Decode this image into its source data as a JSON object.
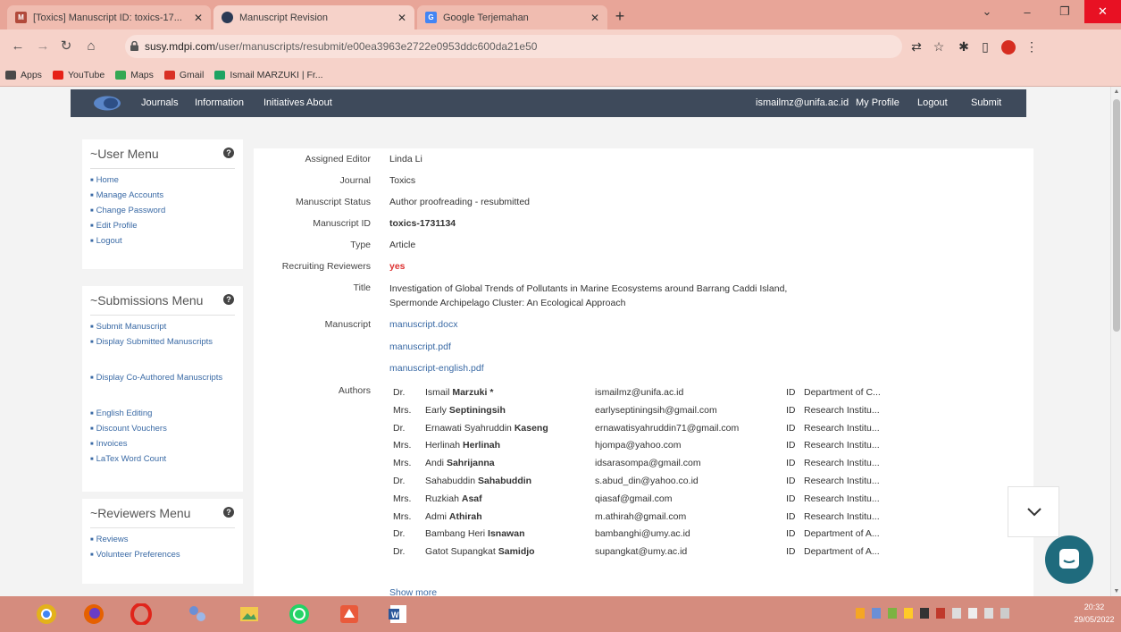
{
  "browser": {
    "tabs": [
      {
        "title": "[Toxics] Manuscript ID: toxics-17...",
        "favicon": "mdpi-icon",
        "active": false
      },
      {
        "title": "Manuscript Revision",
        "favicon": "susy-icon",
        "active": true
      },
      {
        "title": "Google Terjemahan",
        "favicon": "google-translate-icon",
        "active": false
      }
    ],
    "url_host": "susy.mdpi.com",
    "url_path": "/user/manuscripts/resubmit/e00ea3963e2722e0953ddc600da21e50",
    "bookmarks": [
      {
        "label": "Apps",
        "icon": "apps-icon",
        "color": "#4a4a4a"
      },
      {
        "label": "YouTube",
        "icon": "youtube-icon",
        "color": "#e62117"
      },
      {
        "label": "Maps",
        "icon": "maps-icon",
        "color": "#34a853"
      },
      {
        "label": "Gmail",
        "icon": "gmail-icon",
        "color": "#d93025"
      },
      {
        "label": "Ismail MARZUKI | Fr...",
        "icon": "bookmark-site-icon",
        "color": "#1ea362"
      }
    ]
  },
  "site_nav": {
    "links": [
      "Journals",
      "Information",
      "Initiatives",
      "About"
    ],
    "user_email": "ismailmz@unifa.ac.id",
    "right_links": [
      "My Profile",
      "Logout",
      "Submit"
    ]
  },
  "sidebar": {
    "user_menu": {
      "title": "User Menu",
      "items": [
        "Home",
        "Manage Accounts",
        "Change Password",
        "Edit Profile",
        "Logout"
      ]
    },
    "submissions_menu": {
      "title": "Submissions Menu",
      "items": [
        "Submit Manuscript",
        "Display Submitted Manuscripts",
        "Display Co-Authored Manuscripts",
        "English Editing",
        "Discount Vouchers",
        "Invoices",
        "LaTex Word Count"
      ]
    },
    "reviewers_menu": {
      "title": "Reviewers Menu",
      "items": [
        "Reviews",
        "Volunteer Preferences"
      ]
    }
  },
  "manuscript": {
    "labels": {
      "editor": "Assigned Editor",
      "journal": "Journal",
      "status": "Manuscript Status",
      "id": "Manuscript ID",
      "type": "Type",
      "recruiting": "Recruiting Reviewers",
      "title": "Title",
      "files": "Manuscript",
      "authors": "Authors"
    },
    "editor": "Linda Li",
    "journal": "Toxics",
    "status": "Author proofreading - resubmitted",
    "id": "toxics-1731134",
    "type": "Article",
    "recruiting": "yes",
    "title_line1": "Investigation of Global Trends of Pollutants in Marine Ecosystems around Barrang Caddi Island,",
    "title_line2": "Spermonde Archipelago Cluster: An Ecological Approach",
    "files": [
      "manuscript.docx",
      "manuscript.pdf",
      "manuscript-english.pdf"
    ],
    "show_more": "Show more"
  },
  "authors": [
    {
      "honorific": "Dr.",
      "given": "Ismail",
      "family": "Marzuki *",
      "email": "ismailmz@unifa.ac.id",
      "orcid": "ID",
      "affiliation": "Department of C..."
    },
    {
      "honorific": "Mrs.",
      "given": "Early",
      "family": "Septiningsih",
      "email": "earlyseptiningsih@gmail.com",
      "orcid": "ID",
      "affiliation": "Research Institu..."
    },
    {
      "honorific": "Dr.",
      "given": "Ernawati Syahruddin",
      "family": "Kaseng",
      "email": "ernawatisyahruddin71@gmail.com",
      "orcid": "ID",
      "affiliation": "Research Institu..."
    },
    {
      "honorific": "Mrs.",
      "given": "Herlinah",
      "family": "Herlinah",
      "email": "hjompa@yahoo.com",
      "orcid": "ID",
      "affiliation": "Research Institu..."
    },
    {
      "honorific": "Mrs.",
      "given": "Andi",
      "family": "Sahrijanna",
      "email": "idsarasompa@gmail.com",
      "orcid": "ID",
      "affiliation": "Research Institu..."
    },
    {
      "honorific": "Dr.",
      "given": "Sahabuddin",
      "family": "Sahabuddin",
      "email": "s.abud_din@yahoo.co.id",
      "orcid": "ID",
      "affiliation": "Research Institu..."
    },
    {
      "honorific": "Mrs.",
      "given": "Ruzkiah",
      "family": "Asaf",
      "email": "qiasaf@gmail.com",
      "orcid": "ID",
      "affiliation": "Research Institu..."
    },
    {
      "honorific": "Mrs.",
      "given": "Admi",
      "family": "Athirah",
      "email": "m.athirah@gmail.com",
      "orcid": "ID",
      "affiliation": "Research Institu..."
    },
    {
      "honorific": "Dr.",
      "given": "Bambang Heri",
      "family": "Isnawan",
      "email": "bambanghi@umy.ac.id",
      "orcid": "ID",
      "affiliation": "Department of A..."
    },
    {
      "honorific": "Dr.",
      "given": "Gatot Supangkat",
      "family": "Samidjo",
      "email": "supangkat@umy.ac.id",
      "orcid": "ID",
      "affiliation": "Department of A..."
    }
  ],
  "taskbar": {
    "apps": [
      "chrome-icon",
      "firefox-icon",
      "opera-icon",
      "network-app-icon",
      "photos-icon",
      "whatsapp-icon",
      "sketch-app-icon",
      "word-icon"
    ],
    "time": "20:32",
    "date": "29/05/2022"
  },
  "colors": {
    "nav_bg": "#3e4a5b",
    "link": "#3a6aa5",
    "accent_red": "#d33333",
    "chat": "#1f6b7d",
    "tab_strip": "#e8a598"
  }
}
